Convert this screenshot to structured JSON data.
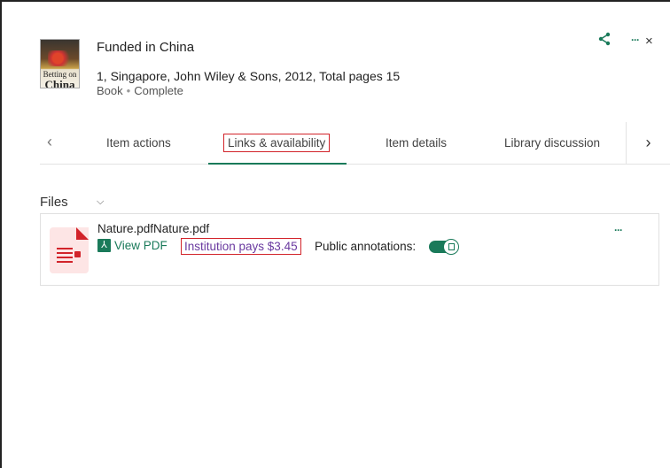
{
  "item": {
    "title": "Funded in China",
    "meta": "1, Singapore, John Wiley & Sons, 2012, Total pages 15",
    "type": "Book",
    "status": "Complete",
    "cover_text_top": "Betting on",
    "cover_text_bottom": "China"
  },
  "header_actions": {
    "share_icon": "share-icon",
    "more_label": "···",
    "close_label": "×"
  },
  "tabs": {
    "prev_label": "‹",
    "next_label": "›",
    "items": [
      {
        "label": "Item actions"
      },
      {
        "label": "Links & availability",
        "active": true
      },
      {
        "label": "Item details"
      },
      {
        "label": "Library discussion"
      }
    ]
  },
  "files": {
    "section_label": "Files",
    "chevron": "⌵",
    "file": {
      "name": "Nature.pdfNature.pdf",
      "view_label": "View PDF",
      "price_label": "Institution pays $3.45",
      "annotations_label": "Public annotations:",
      "annotations_on": true,
      "more_label": "···"
    }
  },
  "colors": {
    "accent": "#1a7a5a",
    "highlight_box": "#d2232a",
    "price_link": "#6a3aa0",
    "pdf_tile": "#fde5e5"
  }
}
